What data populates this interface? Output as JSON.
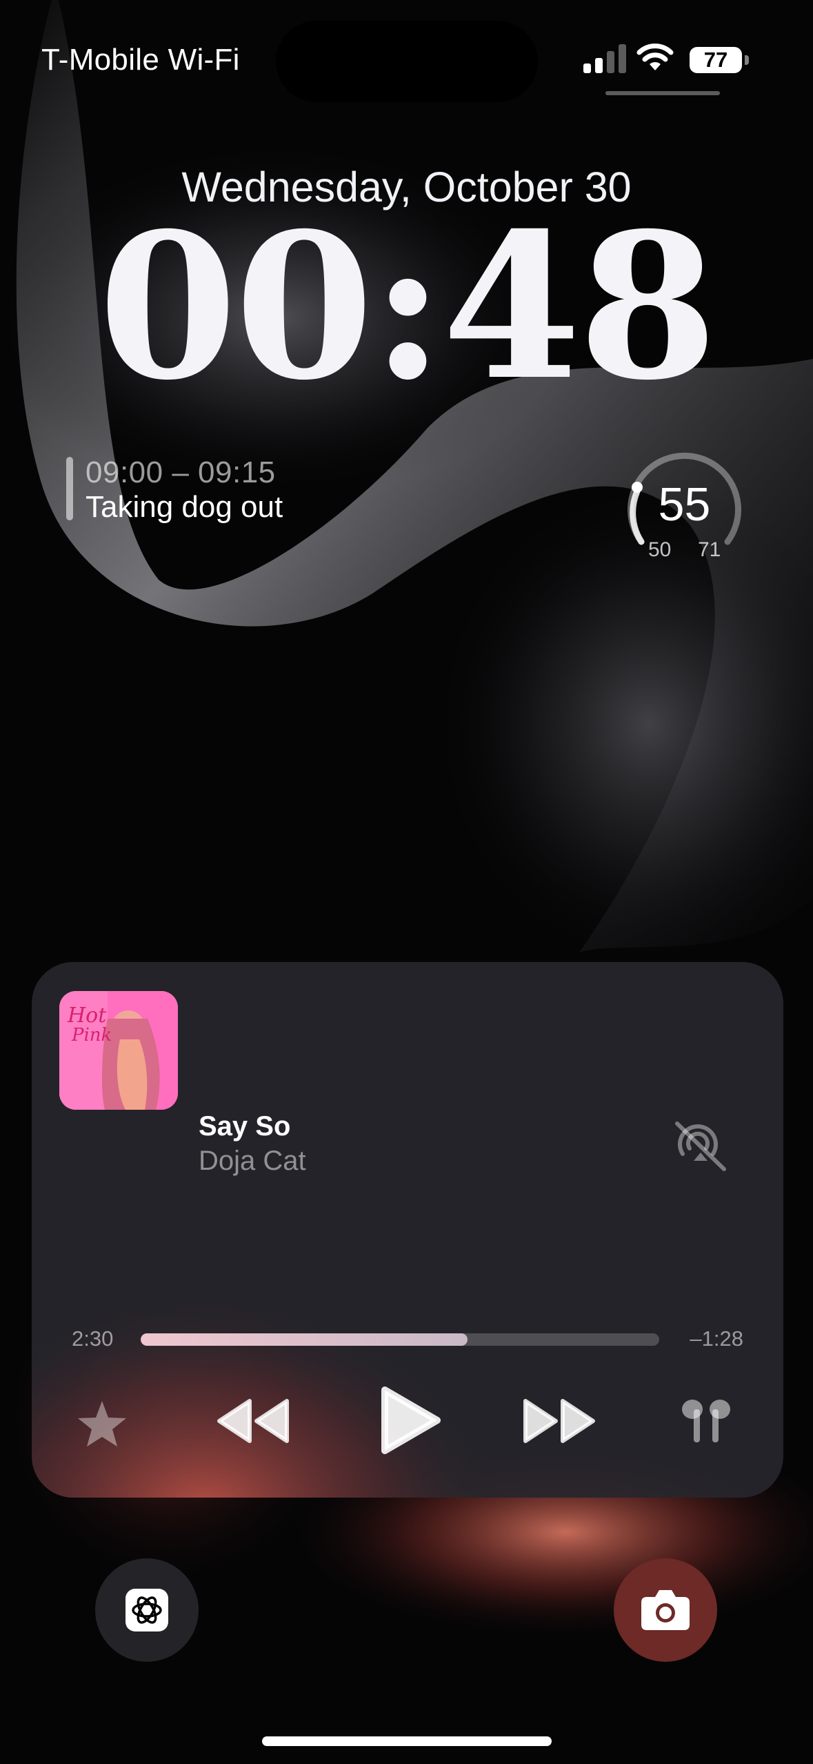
{
  "status_bar": {
    "carrier": "T-Mobile Wi-Fi",
    "battery_percent": "77",
    "signal_bars": 2,
    "signal_total": 4,
    "icons": [
      "cellular-signal-icon",
      "wifi-icon",
      "battery-icon"
    ]
  },
  "lock_screen": {
    "date": "Wednesday, October 30",
    "time": "00:48"
  },
  "calendar_widget": {
    "time_range": "09:00 – 09:15",
    "event_title": "Taking dog out"
  },
  "weather_widget": {
    "current_temp": "55",
    "low_temp": "50",
    "high_temp": "71"
  },
  "now_playing": {
    "title": "Say So",
    "artist": "Doja Cat",
    "elapsed": "2:30",
    "remaining": "–1:28",
    "progress_fraction": 0.63,
    "controls": [
      "star-icon",
      "rewind-icon",
      "play-icon",
      "fast-forward-icon",
      "airpods-icon"
    ],
    "airplay_icon": "airplay-off-icon"
  },
  "shortcuts": {
    "left_icon": "chatgpt-icon",
    "right_icon": "camera-icon"
  },
  "colors": {
    "background": "#050506",
    "player_bg": "#26262c",
    "camera_button": "#6d2a27",
    "album_pink": "#ff5cb4"
  }
}
